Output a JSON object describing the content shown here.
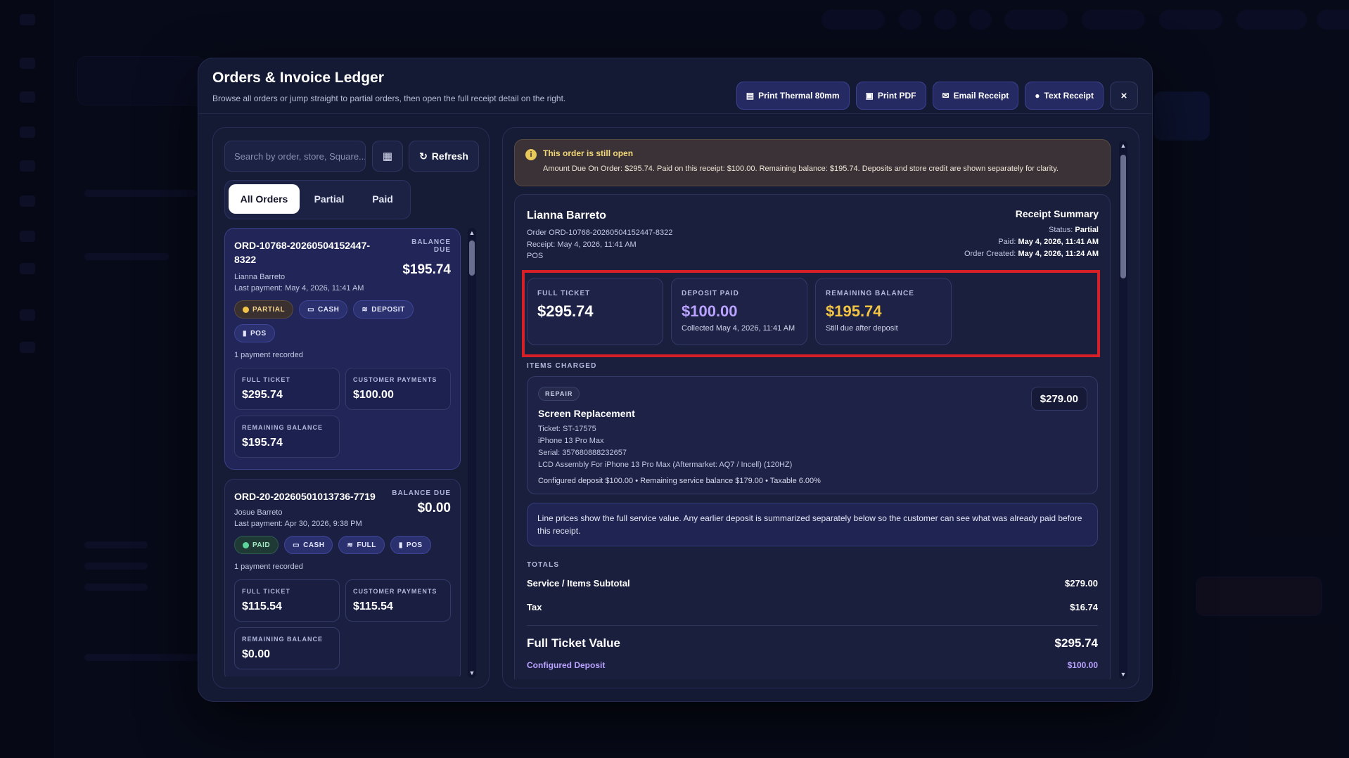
{
  "modal": {
    "title": "Orders & Invoice Ledger",
    "subtitle": "Browse all orders or jump straight to partial orders, then open the full receipt detail on the right.",
    "buttons": {
      "print_thermal": "Print Thermal 80mm",
      "print_pdf": "Print PDF",
      "email_receipt": "Email Receipt",
      "text_receipt": "Text Receipt",
      "close": "×"
    }
  },
  "left": {
    "search_placeholder": "Search by order, store, Square...",
    "refresh_label": "Refresh",
    "tabs": [
      "All Orders",
      "Partial",
      "Paid"
    ],
    "orders": [
      {
        "id": "ORD-10768-20260504152447-8322",
        "customer": "Lianna Barreto",
        "last_payment": "Last payment: May 4, 2026, 11:41 AM",
        "balance_label": "BALANCE DUE",
        "balance": "$195.74",
        "badges": [
          "PARTIAL",
          "CASH",
          "DEPOSIT",
          "POS"
        ],
        "payments_recorded": "1 payment recorded",
        "stats": [
          {
            "label": "FULL TICKET",
            "value": "$295.74"
          },
          {
            "label": "CUSTOMER PAYMENTS",
            "value": "$100.00"
          },
          {
            "label": "REMAINING BALANCE",
            "value": "$195.74"
          }
        ]
      },
      {
        "id": "ORD-20-20260501013736-7719",
        "customer": "Josue Barreto",
        "last_payment": "Last payment: Apr 30, 2026, 9:38 PM",
        "balance_label": "BALANCE DUE",
        "balance": "$0.00",
        "badges": [
          "PAID",
          "CASH",
          "FULL",
          "POS"
        ],
        "payments_recorded": "1 payment recorded",
        "stats": [
          {
            "label": "FULL TICKET",
            "value": "$115.54"
          },
          {
            "label": "CUSTOMER PAYMENTS",
            "value": "$115.54"
          },
          {
            "label": "REMAINING BALANCE",
            "value": "$0.00"
          }
        ]
      }
    ]
  },
  "alert": {
    "title": "This order is still open",
    "text": "Amount Due On Order: $295.74. Paid on this receipt: $100.00. Remaining balance: $195.74. Deposits and store credit are shown separately for clarity."
  },
  "receipt": {
    "customer": "Lianna Barreto",
    "order_line": "Order ORD-10768-20260504152447-8322",
    "receipt_line": "Receipt: May 4, 2026, 11:41 AM",
    "source": "POS",
    "summary_title": "Receipt Summary",
    "status_label": "Status:",
    "status_value": "Partial",
    "paid_label": "Paid:",
    "paid_value": "May 4, 2026, 11:41 AM",
    "created_label": "Order Created:",
    "created_value": "May 4, 2026, 11:24 AM",
    "cards": [
      {
        "label": "FULL TICKET",
        "value": "$295.74",
        "sub": ""
      },
      {
        "label": "DEPOSIT PAID",
        "value": "$100.00",
        "sub": "Collected May 4, 2026, 11:41 AM"
      },
      {
        "label": "REMAINING BALANCE",
        "value": "$195.74",
        "sub": "Still due after deposit"
      }
    ],
    "items_label": "ITEMS CHARGED",
    "item": {
      "tag": "REPAIR",
      "price": "$279.00",
      "name": "Screen Replacement",
      "ticket": "Ticket: ST-17575",
      "device": "iPhone 13 Pro Max",
      "serial": "Serial: 357680888232657",
      "part": "LCD Assembly For iPhone 13 Pro Max (Aftermarket: AQ7 / Incell) (120HZ)",
      "footer": "Configured deposit $100.00 • Remaining service balance $179.00 • Taxable 6.00%"
    },
    "note": "Line prices show the full service value. Any earlier deposit is summarized separately below so the customer can see what was already paid before this receipt.",
    "totals_label": "TOTALS",
    "totals": {
      "subtotal_label": "Service / Items Subtotal",
      "subtotal": "$279.00",
      "tax_label": "Tax",
      "tax": "$16.74",
      "full_label": "Full Ticket Value",
      "full": "$295.74",
      "deposit_label": "Configured Deposit",
      "deposit": "$100.00"
    }
  },
  "colors": {
    "accent_purple": "#b9a3ff",
    "balance_yellow": "#f4c542",
    "highlight_red": "#d61f26"
  }
}
